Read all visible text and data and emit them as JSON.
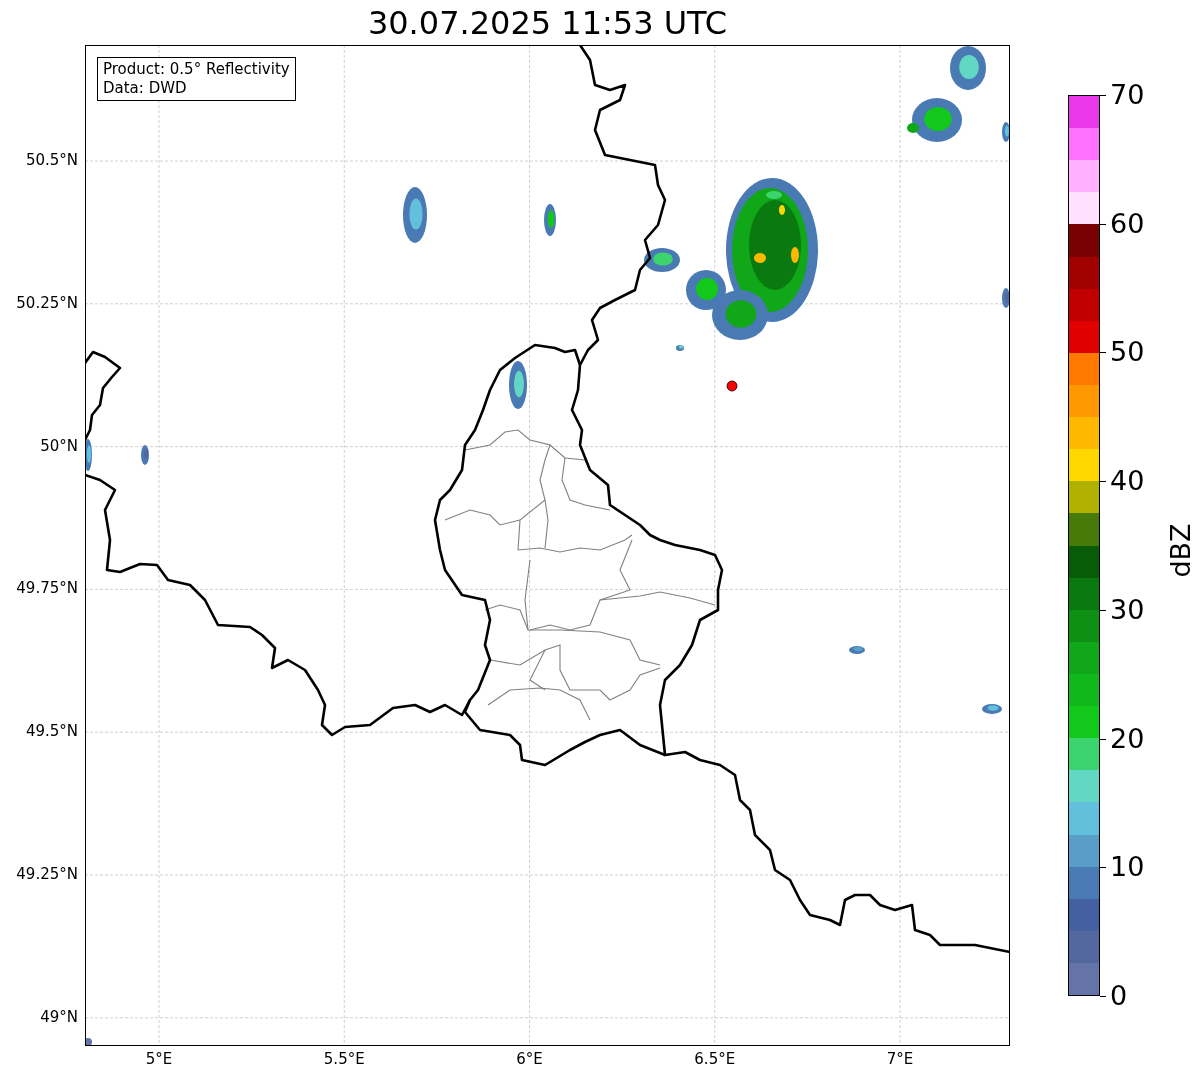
{
  "title": "30.07.2025 11:53 UTC",
  "info_box": {
    "lines": [
      "Product: 0.5° Reflectivity",
      "Data: DWD"
    ]
  },
  "lat_ticks": [
    "50.5°N",
    "50.25°N",
    "50°N",
    "49.75°N",
    "49.5°N",
    "49.25°N",
    "49°N"
  ],
  "lon_ticks": [
    "5°E",
    "5.5°E",
    "6°E",
    "6.5°E",
    "7°E"
  ],
  "colorbar": {
    "ticks": [
      "70",
      "60",
      "50",
      "40",
      "30",
      "20",
      "10",
      "0"
    ],
    "label": "dBZ",
    "bins": [
      {
        "color": "#e838e8"
      },
      {
        "color": "#ff70ff"
      },
      {
        "color": "#ffb0ff"
      },
      {
        "color": "#ffe0ff"
      },
      {
        "color": "#780000"
      },
      {
        "color": "#a00000"
      },
      {
        "color": "#c00000"
      },
      {
        "color": "#e00000"
      },
      {
        "color": "#ff7800"
      },
      {
        "color": "#ff9800"
      },
      {
        "color": "#ffb800"
      },
      {
        "color": "#ffd800"
      },
      {
        "color": "#b0b000"
      },
      {
        "color": "#487a0a"
      },
      {
        "color": "#085c08"
      },
      {
        "color": "#0a7a10"
      },
      {
        "color": "#0e9014"
      },
      {
        "color": "#10a818"
      },
      {
        "color": "#10b81c"
      },
      {
        "color": "#12c81a"
      },
      {
        "color": "#3cd46e"
      },
      {
        "color": "#62d8c4"
      },
      {
        "color": "#62c0dc"
      },
      {
        "color": "#5a9ec8"
      },
      {
        "color": "#4a7ab4"
      },
      {
        "color": "#4460a0"
      },
      {
        "color": "#5468a0"
      },
      {
        "color": "#6474a8"
      }
    ]
  }
}
